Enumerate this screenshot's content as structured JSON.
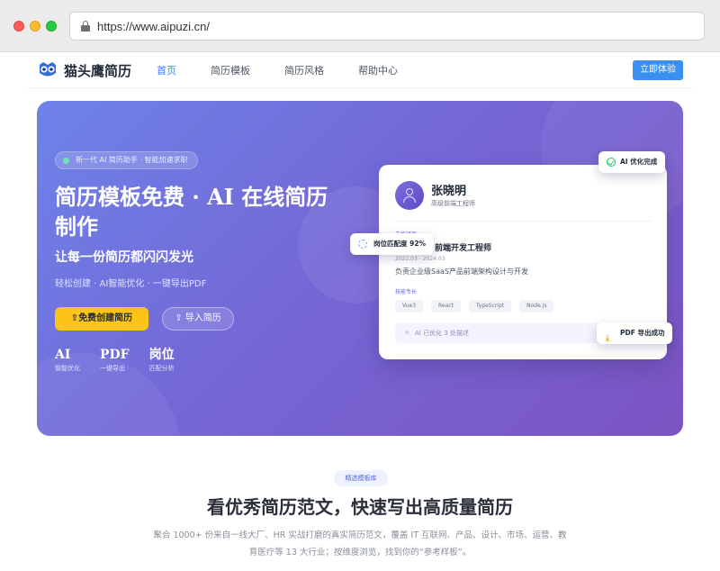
{
  "browser": {
    "url": "https://www.aipuzi.cn/"
  },
  "header": {
    "logo_text": "猫头鹰简历",
    "nav": [
      {
        "label": "首页",
        "active": true
      },
      {
        "label": "简历模板",
        "active": false
      },
      {
        "label": "简历风格",
        "active": false
      },
      {
        "label": "帮助中心",
        "active": false
      }
    ],
    "cta_label": "立即体验"
  },
  "hero": {
    "badge": "新一代 AI 简历助手 · 智能加速求职",
    "title": "简历模板免费 · AI 在线简历制作",
    "subtitle": "让每一份简历都闪闪发光",
    "tagline": "轻松创建 · AI智能优化 · 一键导出PDF",
    "primary_button": "免费创建简历",
    "secondary_button": "导入简历",
    "stats": [
      {
        "big": "AI",
        "small": "智能优化"
      },
      {
        "big": "PDF",
        "small": "一键导出"
      },
      {
        "big": "岗位",
        "small": "匹配分析"
      }
    ]
  },
  "resume_card": {
    "name": "张晓明",
    "role": "高级前端工程师",
    "section_label": "工作经历",
    "job_title": "前端开发工程师",
    "date_range": "2022.03 - 2024.03",
    "description": "负责企业级SaaS产品前端架构设计与开发",
    "skills_label": "技能专长",
    "skills": [
      "Vue3",
      "React",
      "TypeScript",
      "Node.js"
    ],
    "ai_status": "AI 已优化 3 处描述"
  },
  "floating_badges": {
    "ai_done": "AI 优化完成",
    "match": "岗位匹配度 92%",
    "pdf_done": "PDF 导出成功"
  },
  "templates_section": {
    "badge": "精选模板库",
    "title": "看优秀简历范文，快速写出高质量简历",
    "description": "聚合 1000+ 份来自一线大厂、HR 实战打磨的真实简历范文，覆盖 IT 互联网、产品、设计、市场、运营、教育医疗等 13 大行业；按维度浏览，找到你的“参考样板”。"
  },
  "colors": {
    "brand_blue": "#3b8ff0",
    "hero_gradient_start": "#6d83e8",
    "hero_gradient_end": "#7c54c2",
    "primary_button": "#fcc419"
  },
  "icons": [
    "lock-icon",
    "owl-logo-icon",
    "upload-icon",
    "check-icon",
    "target-icon",
    "download-icon",
    "sparkle-icon",
    "user-avatar-icon"
  ]
}
